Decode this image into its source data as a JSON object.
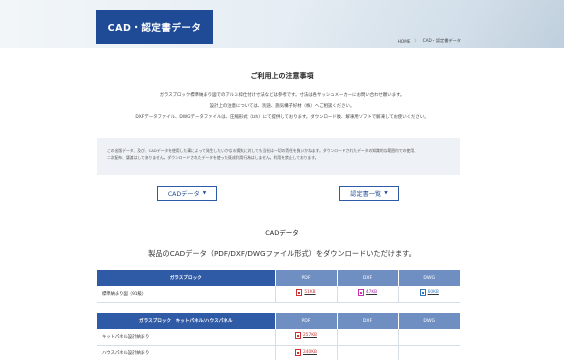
{
  "header": {
    "title": "CAD・認定書データ"
  },
  "breadcrumb": {
    "home": "HOME",
    "separator": "〉",
    "current": "CAD・認定書データ"
  },
  "notice": {
    "title": "ご利用上の注意事項",
    "lines": [
      "ガラスブロック標準納まり図でのアルミ枠仕付け寸法などは参考です。寸法は各サッシュメーカーにお問い合わせ願います。",
      "設計上の注意については、別途、施気構子好材（株）へご相談ください。",
      "DXFデータファイル、DWGデータファイルは、圧縮形式（lzh）にて提供しております。ダウンロード後、解凍用ソフトで解凍してお使いください。"
    ],
    "box_lines": [
      "この出版データ、及び、CADデータを使用した事によって発生したいかなる損失に対しても当社は一切の責任を負いかねます。ダウンロードされたデータの知識的な範囲内での使用、",
      "二次配布、譲渡はしてありません。ダウンロードされたデータを使った既成利用行為はしません。利用を禁止しております。"
    ]
  },
  "buttons": {
    "cad": "CADデータ",
    "cert": "認定書一覧"
  },
  "cad_section": {
    "title": "CADデータ",
    "subtitle": "製品のCADデータ（PDF/DXF/DWGファイル形式）をダウンロードいただけます。"
  },
  "table1": {
    "header": "ガラスブロック",
    "col_pdf": "PDF",
    "col_dxf": "DXF",
    "col_dwg": "DWG",
    "rows": [
      {
        "name": "標準納まり図（91級）",
        "pdf": "51KB",
        "dxf": "47KB",
        "dwg": "60KB"
      }
    ]
  },
  "table2": {
    "header": "ガラスブロック　キットパネル/ハウスパネル",
    "col_pdf": "PDF",
    "col_dxf": "DXF",
    "col_dwg": "DWG",
    "rows": [
      {
        "name": "キットパネル設計納まり",
        "pdf": "257KB"
      },
      {
        "name": "ハウスパネル設計納まり",
        "pdf": "240KB"
      }
    ]
  }
}
